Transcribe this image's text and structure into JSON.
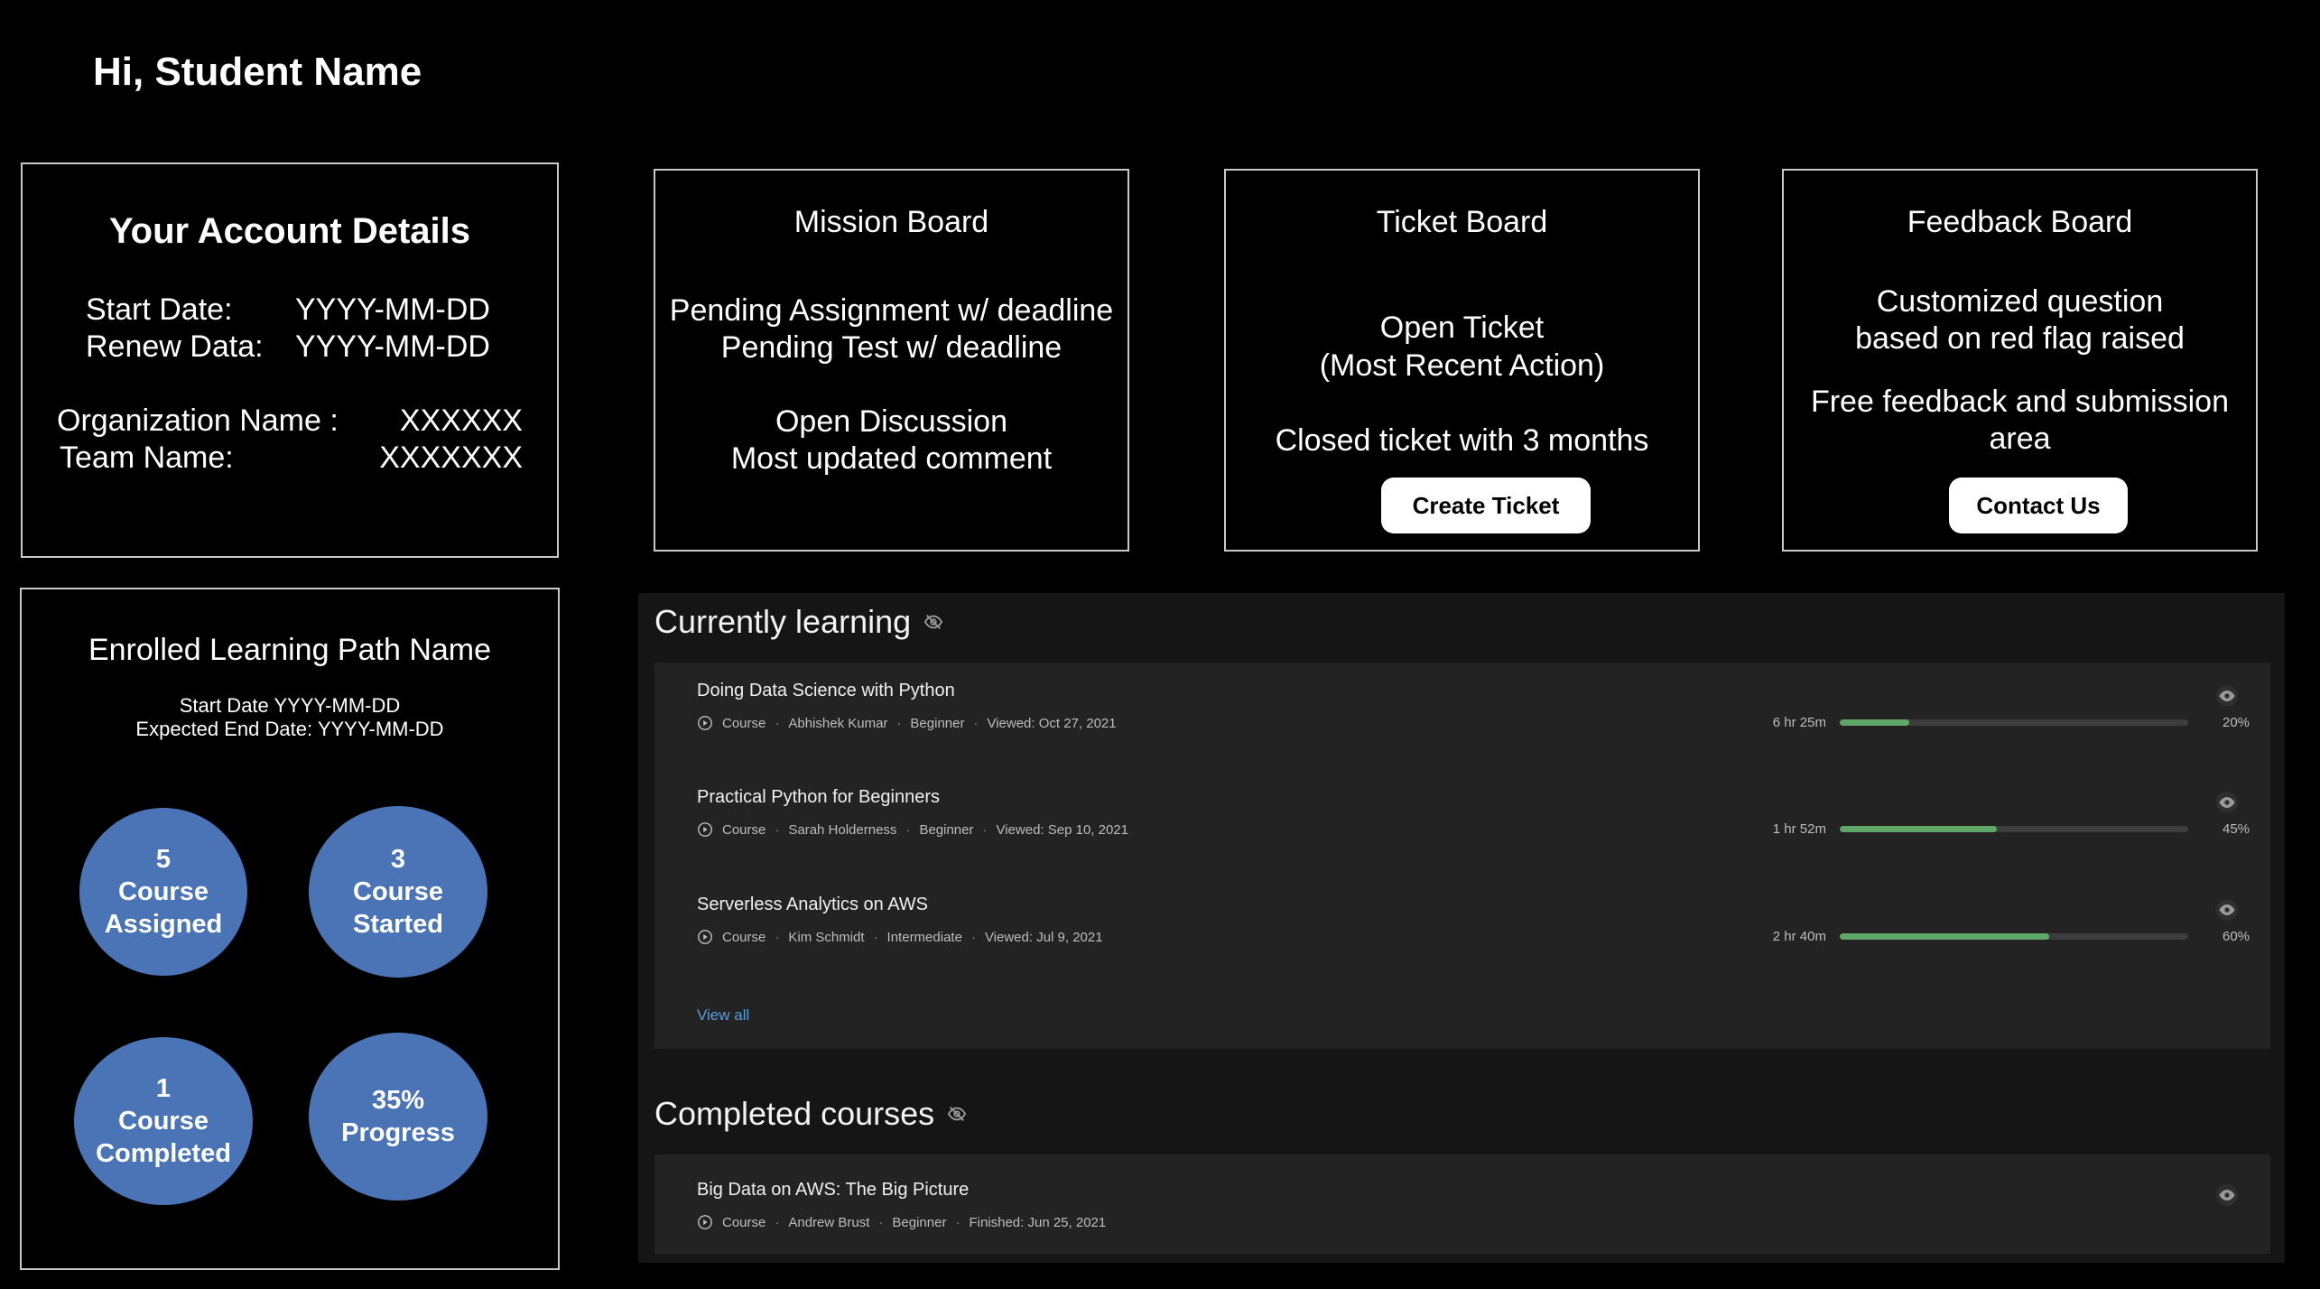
{
  "greeting": "Hi, Student Name",
  "account": {
    "title": "Your Account Details",
    "start_label": "Start Date:",
    "start_value": "YYYY-MM-DD",
    "renew_label": "Renew Data:",
    "renew_value": "YYYY-MM-DD",
    "org_label": "Organization Name :",
    "org_value": "XXXXXX",
    "team_label": "Team Name:",
    "team_value": "XXXXXXX"
  },
  "mission_board": {
    "title": "Mission Board",
    "line1": "Pending Assignment w/ deadline",
    "line2": "Pending Test w/ deadline",
    "line3": "Open Discussion",
    "line4": "Most updated comment"
  },
  "ticket_board": {
    "title": "Ticket  Board",
    "line1": "Open Ticket",
    "line2": "(Most Recent Action)",
    "line3": "Closed ticket with 3 months",
    "button": "Create Ticket"
  },
  "feedback_board": {
    "title": "Feedback Board",
    "line1": "Customized question",
    "line2": "based on red flag raised",
    "line3": "Free feedback and submission",
    "line4": "area",
    "button": "Contact Us"
  },
  "learning_path": {
    "title": "Enrolled Learning Path Name",
    "start": "Start Date YYYY-MM-DD",
    "end": "Expected End Date: YYYY-MM-DD",
    "stats": [
      {
        "value": "5",
        "line1": "Course",
        "line2": "Assigned"
      },
      {
        "value": "3",
        "line1": "Course",
        "line2": "Started"
      },
      {
        "value": "1",
        "line1": "Course",
        "line2": "Completed"
      },
      {
        "value": "35%",
        "line1": "Progress",
        "line2": ""
      }
    ]
  },
  "currently_learning": {
    "title": "Currently learning",
    "courses": [
      {
        "title": "Doing Data Science with Python",
        "type": "Course",
        "author": "Abhishek Kumar",
        "level": "Beginner",
        "viewed": "Viewed: Oct 27, 2021",
        "duration": "6 hr 25m",
        "progress_pct": "20%",
        "progress": 20
      },
      {
        "title": "Practical Python for Beginners",
        "type": "Course",
        "author": "Sarah Holderness",
        "level": "Beginner",
        "viewed": "Viewed: Sep 10, 2021",
        "duration": "1 hr 52m",
        "progress_pct": "45%",
        "progress": 45
      },
      {
        "title": "Serverless Analytics on AWS",
        "type": "Course",
        "author": "Kim Schmidt",
        "level": "Intermediate",
        "viewed": "Viewed: Jul 9, 2021",
        "duration": "2 hr 40m",
        "progress_pct": "60%",
        "progress": 60
      }
    ],
    "view_all": "View all"
  },
  "completed_courses": {
    "title": "Completed courses",
    "courses": [
      {
        "title": "Big Data on AWS: The Big Picture",
        "type": "Course",
        "author": "Andrew Brust",
        "level": "Beginner",
        "finished": "Finished: Jun 25, 2021"
      }
    ]
  },
  "colors": {
    "background": "#000000",
    "panel": "#151515",
    "card": "#232324",
    "stat_circle": "#4a74b6",
    "progress_fill": "#5fa867",
    "link": "#5b9bd8"
  }
}
